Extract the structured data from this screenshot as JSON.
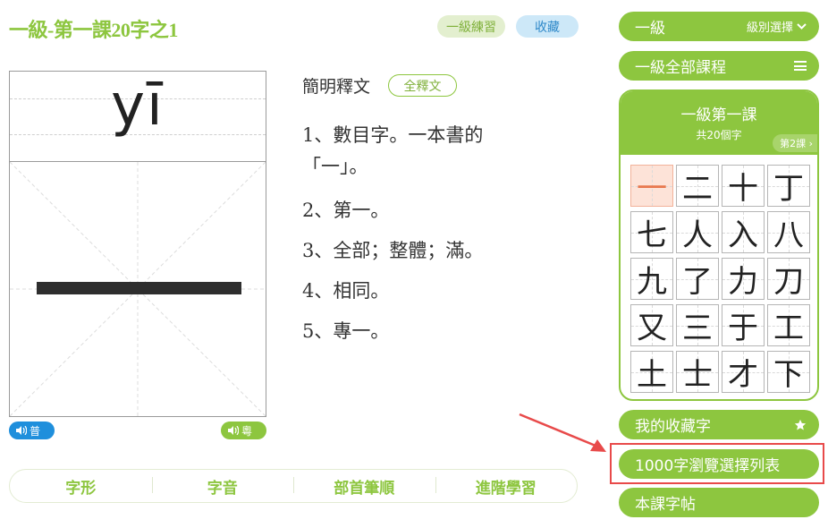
{
  "page_title": "一級-第一課20字之1",
  "actions": {
    "practice": "一級練習",
    "favorite": "收藏"
  },
  "character": {
    "pinyin": "yī"
  },
  "audio": {
    "mandarin": "普",
    "cantonese": "粵"
  },
  "definition": {
    "header": "簡明釋文",
    "full_button": "全釋文",
    "items": [
      "1、數目字。一本書的「一」。",
      "2、第一。",
      "3、全部；整體；滿。",
      "4、相同。",
      "5、專一。"
    ]
  },
  "tabs": [
    "字形",
    "字音",
    "部首筆順",
    "進階學習"
  ],
  "sidebar": {
    "level": "一級",
    "level_select": "級別選擇",
    "all_lessons": "一級全部課程",
    "lesson_title": "一級第一課",
    "lesson_count": "共20個字",
    "next_lesson": "第2課",
    "characters": [
      "一",
      "二",
      "十",
      "丁",
      "七",
      "人",
      "入",
      "八",
      "九",
      "了",
      "力",
      "刀",
      "又",
      "三",
      "于",
      "工",
      "土",
      "士",
      "才",
      "下"
    ],
    "active_index": 0,
    "favorites": "我的收藏字",
    "browse_1000": "1000字瀏覽選擇列表",
    "copybook": "本課字帖"
  },
  "colors": {
    "accent": "#8dc63f",
    "mandarin": "#1f8fdc",
    "highlight": "#e84a4a"
  }
}
